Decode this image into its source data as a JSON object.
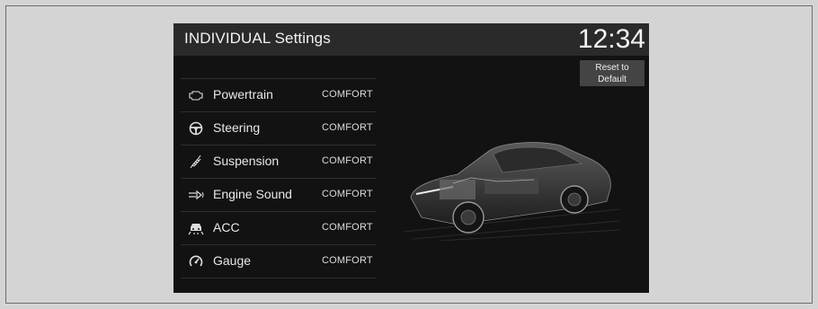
{
  "header": {
    "title": "INDIVIDUAL Settings",
    "clock": "12:34"
  },
  "reset_button": {
    "line1": "Reset to",
    "line2": "Default"
  },
  "menu": [
    {
      "label": "Powertrain",
      "value": "COMFORT",
      "icon": "powertrain-icon"
    },
    {
      "label": "Steering",
      "value": "COMFORT",
      "icon": "steering-wheel-icon"
    },
    {
      "label": "Suspension",
      "value": "COMFORT",
      "icon": "suspension-icon"
    },
    {
      "label": "Engine Sound",
      "value": "COMFORT",
      "icon": "engine-sound-icon"
    },
    {
      "label": "ACC",
      "value": "COMFORT",
      "icon": "acc-icon"
    },
    {
      "label": "Gauge",
      "value": "COMFORT",
      "icon": "gauge-icon"
    }
  ],
  "illustration": {
    "icon": "car-cutaway-image"
  }
}
